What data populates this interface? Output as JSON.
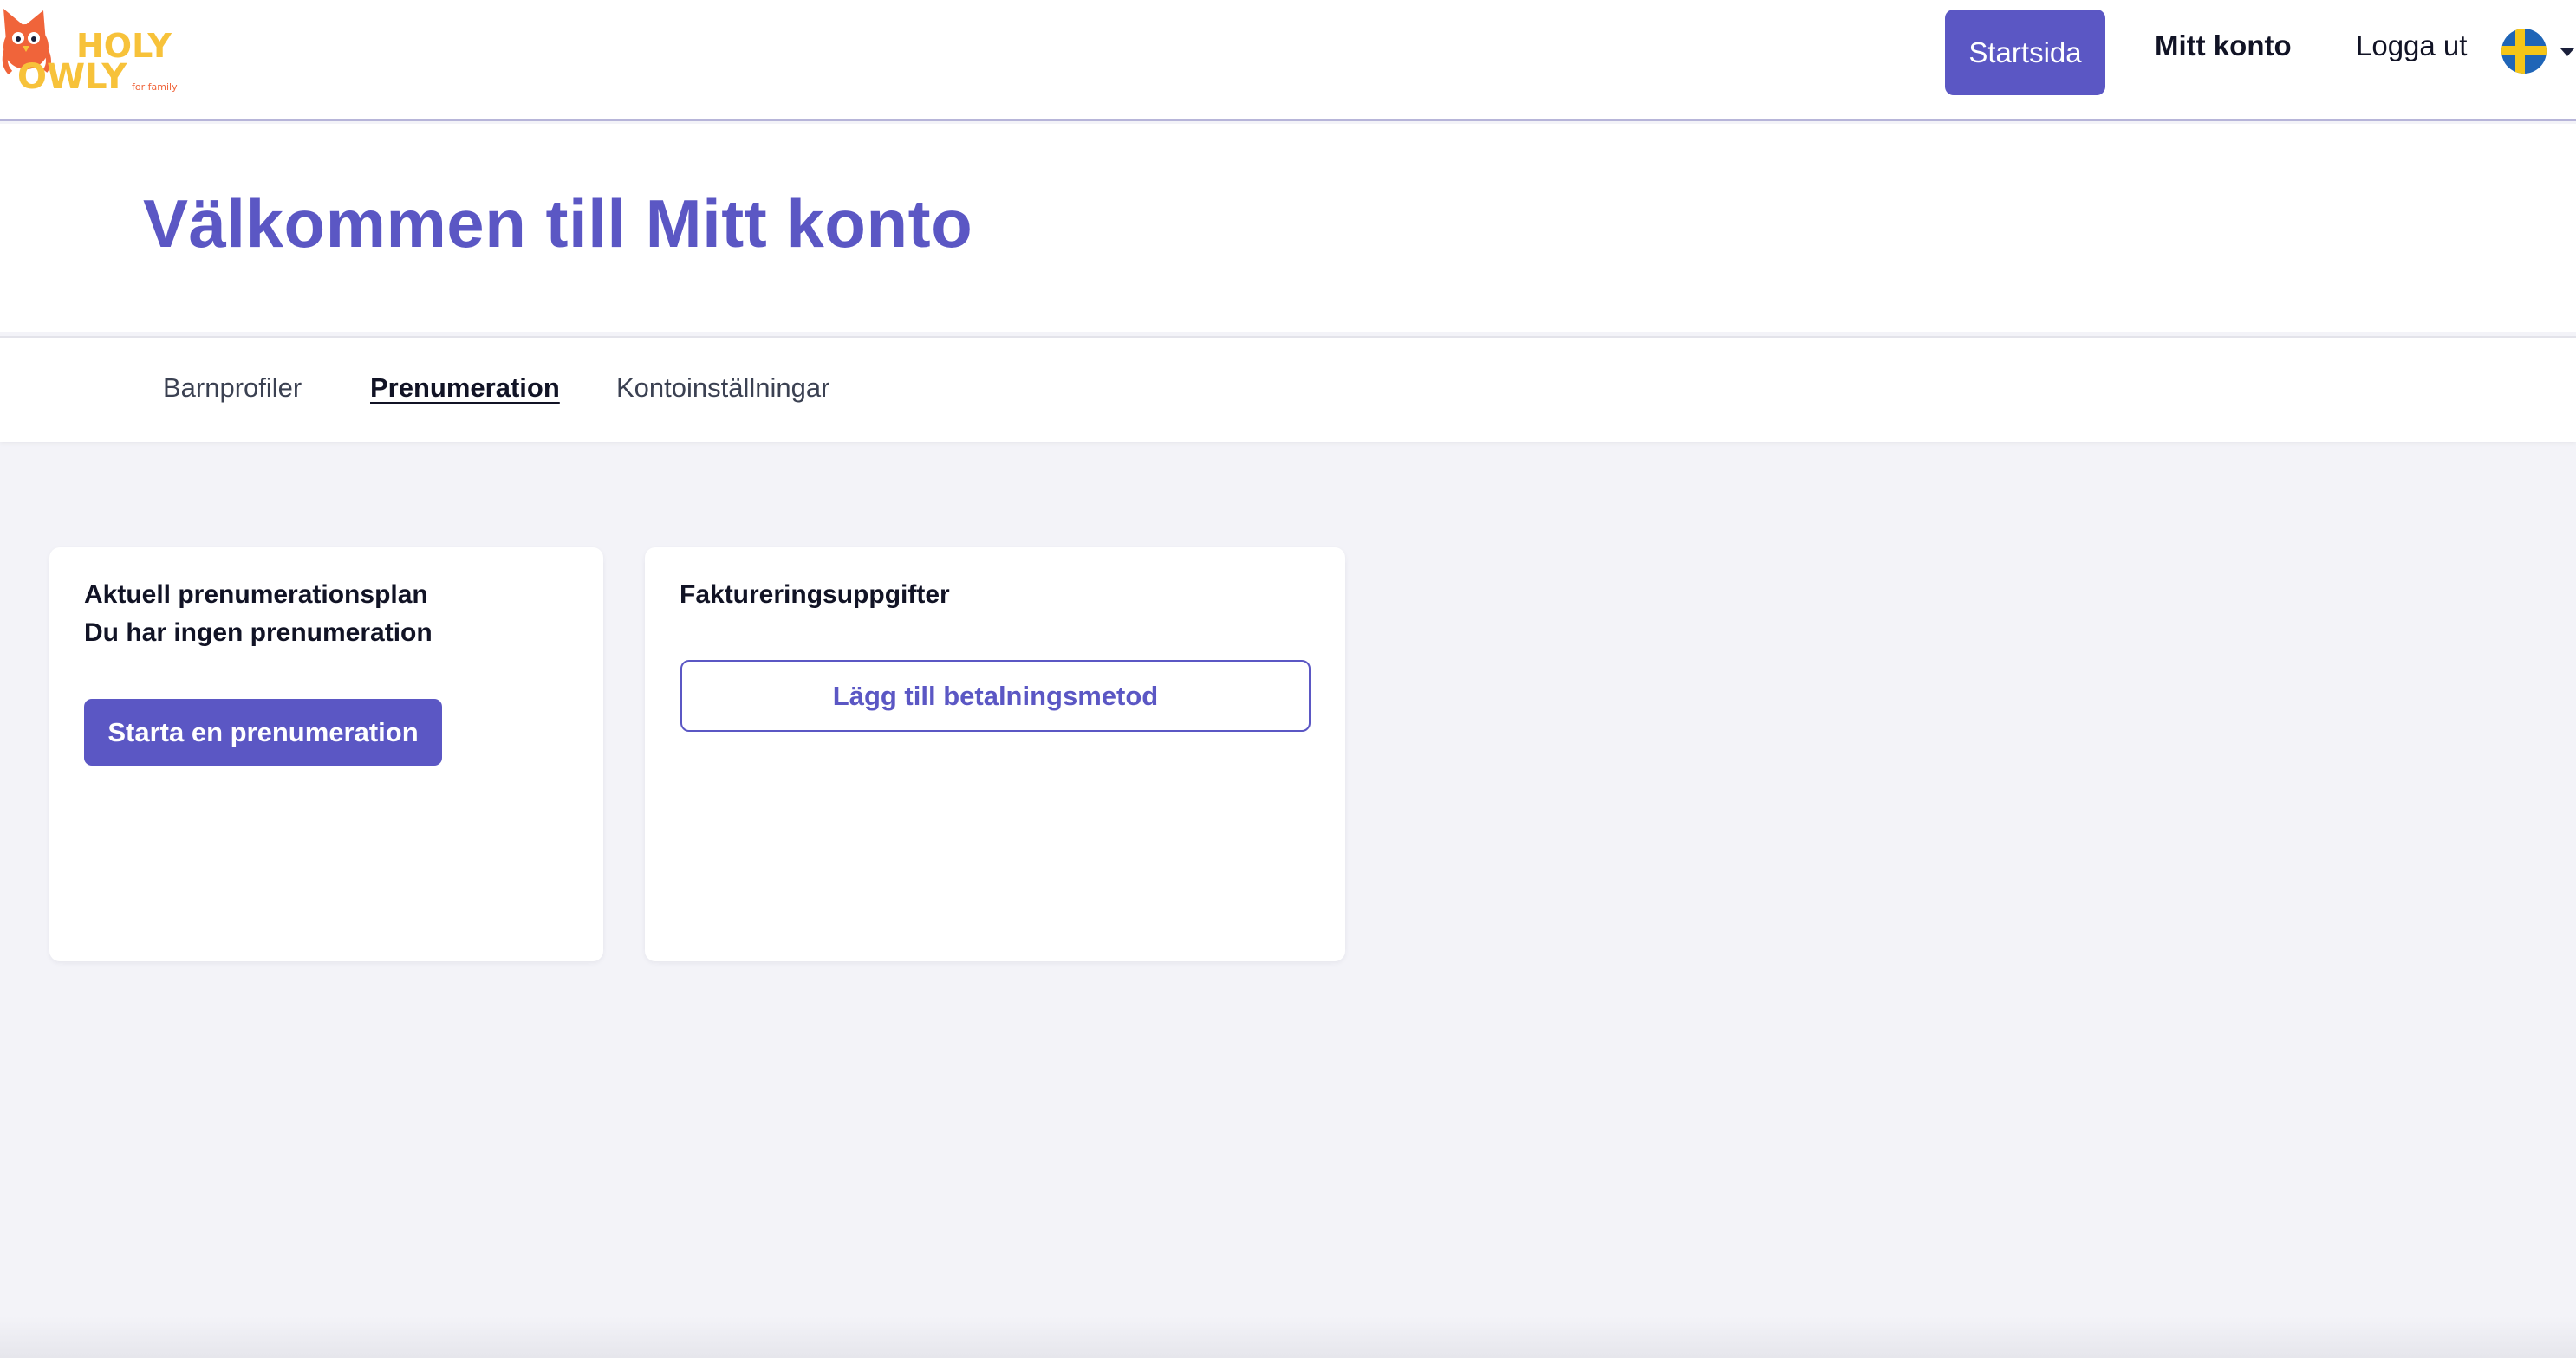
{
  "header": {
    "logo": {
      "line1": "HOLY",
      "line2": "OWLY",
      "tagline": "for family"
    },
    "nav": {
      "home_label": "Startsida",
      "account_label": "Mitt konto",
      "logout_label": "Logga ut"
    },
    "language": {
      "flag_icon": "sweden-flag-icon",
      "dropdown_icon": "caret-down-icon"
    }
  },
  "welcome": {
    "title": "Välkommen till Mitt konto"
  },
  "tabs": [
    {
      "label": "Barnprofiler"
    },
    {
      "label": "Prenumeration"
    },
    {
      "label": "Kontoinställningar"
    }
  ],
  "subscription_card": {
    "title": "Aktuell prenumerationsplan",
    "status": "Du har ingen prenumeration",
    "start_button": "Starta en prenumeration"
  },
  "billing_card": {
    "title": "Faktureringsuppgifter",
    "add_payment_button": "Lägg till betalningsmetod"
  },
  "colors": {
    "accent": "#5b57c4",
    "background": "#f3f3f8",
    "logo_orange": "#f0643a",
    "logo_yellow": "#f7c23a"
  }
}
